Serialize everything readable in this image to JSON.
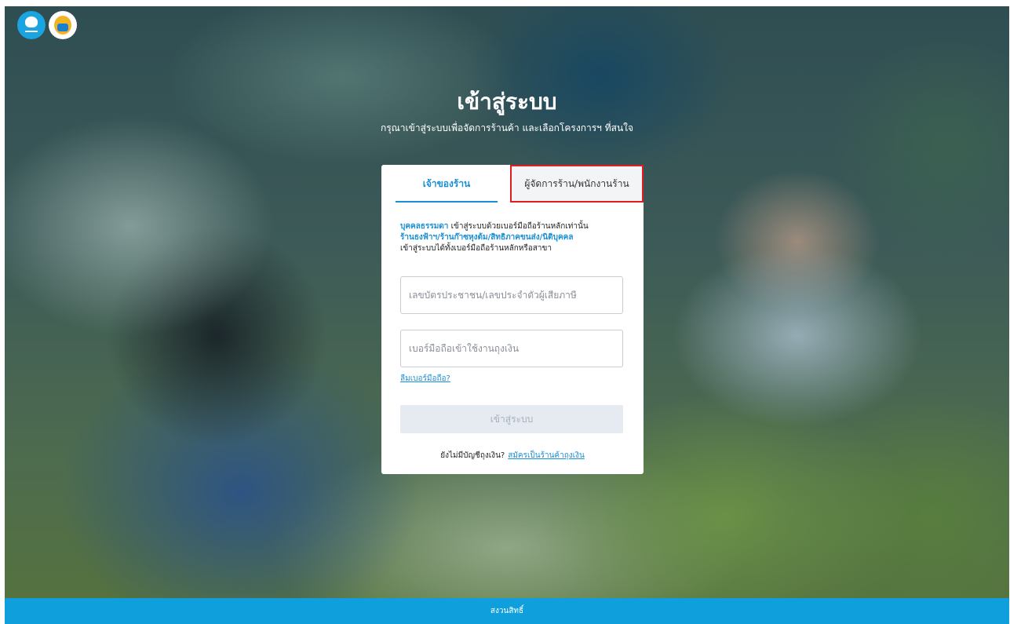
{
  "header": {
    "bank_logo": "krungthai-logo-icon",
    "project_logo": "project-logo-icon"
  },
  "page": {
    "title": "เข้าสู่ระบบ",
    "subtitle": "กรุณาเข้าสู่ระบบเพื่อจัดการร้านค้า และเลือกโครงการฯ ที่สนใจ"
  },
  "tabs": {
    "owner": "เจ้าของร้าน",
    "manager": "ผู้จัดการร้าน/พนักงานร้าน"
  },
  "info": {
    "line1_highlight": "บุคคลธรรมดา",
    "line1_text": " เข้าสู่ระบบด้วยเบอร์มือถือร้านหลักเท่านั้น",
    "line2_highlight": "ร้านธงฟ้าฯ/ร้านก๊าซหุงต้ม/สิทธิภาคขนส่ง/นิติบุคคล",
    "line3_text": "เข้าสู่ระบบได้ทั้งเบอร์มือถือร้านหลักหรือสาขา"
  },
  "form": {
    "id_placeholder": "เลขบัตรประชาชน/เลขประจำตัวผู้เสียภาษี",
    "phone_placeholder": "เบอร์มือถือเข้าใช้งานถุงเงิน",
    "forgot_link": "ลืมเบอร์มือถือ?",
    "login_button": "เข้าสู่ระบบ"
  },
  "signup": {
    "prompt": "ยังไม่มีบัญชีถุงเงิน?",
    "link": "สมัครเป็นร้านค้าถุงเงิน"
  },
  "footer": {
    "text": "สงวนสิทธิ์"
  },
  "colors": {
    "accent": "#1a8fd6",
    "footer": "#0f9fdc",
    "highlight_border": "#e11d24"
  }
}
